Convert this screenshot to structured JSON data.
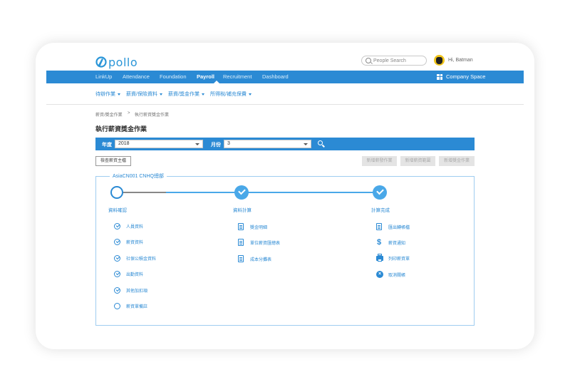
{
  "app": {
    "logo_text": "pollo"
  },
  "header": {
    "search_placeholder": "People Search",
    "greeting": "Hi, Batman"
  },
  "nav": {
    "items": [
      "LinkUp",
      "Attendance",
      "Foundation",
      "Payroll",
      "Recruitment",
      "Dashboard"
    ],
    "active": "Payroll",
    "company_space": "Company Space"
  },
  "subnav": {
    "items": [
      "待辦作業",
      "薪資/保險資料",
      "薪資/獎金作業",
      "所得稅/補充保費"
    ]
  },
  "breadcrumb": {
    "items": [
      "薪資/獎金作業",
      ">",
      "執行薪資獎金作業"
    ]
  },
  "page": {
    "title": "執行薪資獎金作業"
  },
  "filter": {
    "year_label": "年度",
    "year_value": "2018",
    "month_label": "月份",
    "month_value": "3"
  },
  "buttons": {
    "check_master": "檢查薪資主檔",
    "grey": [
      "新增薪發作業",
      "新增薪資範圍",
      "新增獎金作業"
    ]
  },
  "panel": {
    "title": "AsiaCN001 CNHQ總部",
    "steps": [
      {
        "label": "資料確認",
        "state": "current"
      },
      {
        "label": "資料計算",
        "state": "done"
      },
      {
        "label": "計算完成",
        "state": "done"
      }
    ],
    "col1": [
      {
        "label": "人員資料",
        "icon": "check-circle-icon"
      },
      {
        "label": "薪資資料",
        "icon": "check-circle-icon"
      },
      {
        "label": "社保公積金資料",
        "icon": "check-circle-icon"
      },
      {
        "label": "出勤資料",
        "icon": "check-circle-icon"
      },
      {
        "label": "其他加扣項",
        "icon": "check-circle-icon"
      },
      {
        "label": "薪資單備註",
        "icon": "empty-circle-icon"
      }
    ],
    "col2": [
      {
        "label": "獎金明細",
        "icon": "document-icon"
      },
      {
        "label": "單位薪資匯總表",
        "icon": "document-icon"
      },
      {
        "label": "成本分攤表",
        "icon": "document-icon"
      }
    ],
    "col3": [
      {
        "label": "匯出轉帳檔",
        "icon": "document-icon"
      },
      {
        "label": "薪資通知",
        "icon": "dollar-icon"
      },
      {
        "label": "列印薪資單",
        "icon": "printer-icon"
      },
      {
        "label": "取消關帳",
        "icon": "close-circle-icon"
      }
    ]
  },
  "colors": {
    "accent": "#2b8ad4",
    "light_accent": "#4aa8e8",
    "grey_button": "#e4e4e4"
  }
}
